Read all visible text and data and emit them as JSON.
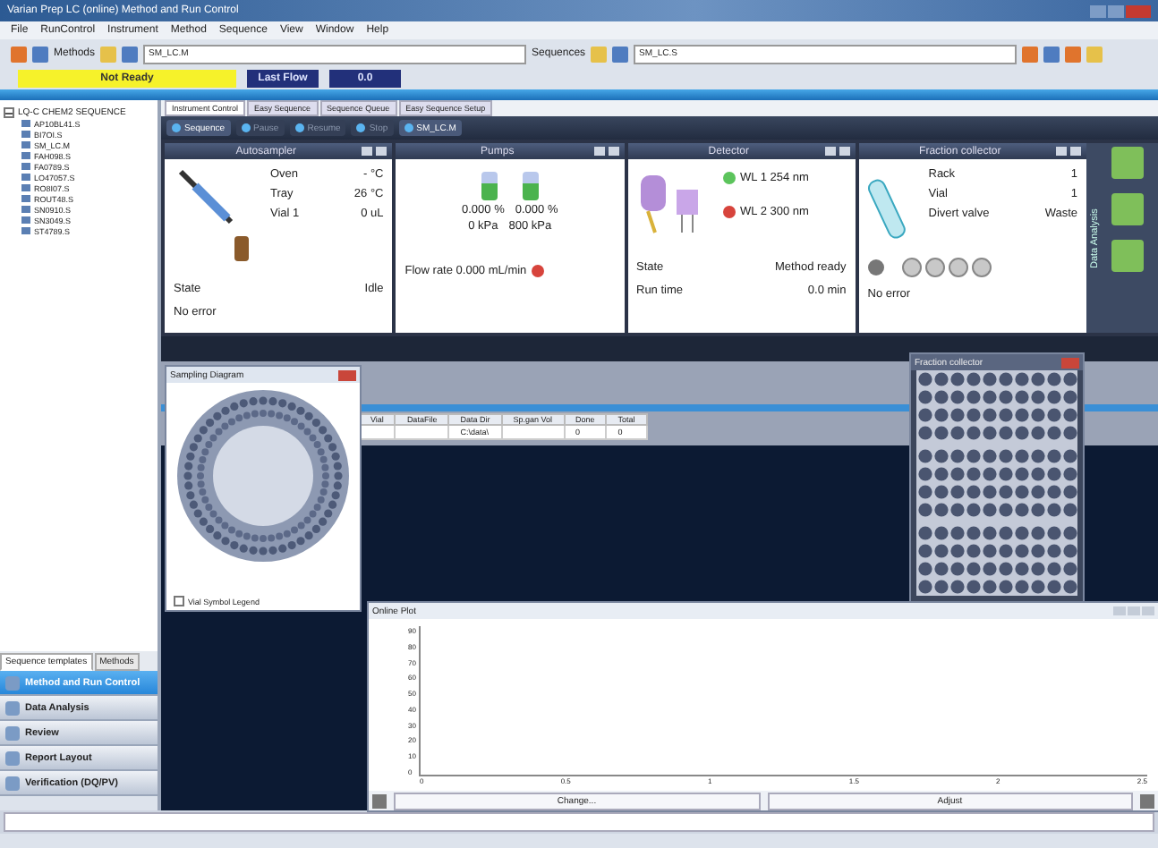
{
  "window": {
    "title": "Varian Prep LC (online) Method and Run Control"
  },
  "menu": [
    "File",
    "RunControl",
    "Instrument",
    "Method",
    "Sequence",
    "View",
    "Window",
    "Help"
  ],
  "toolbar": {
    "methods_label": "Methods",
    "method_value": "SM_LC.M",
    "sequences_label": "Sequences",
    "sequence_value": "SM_LC.S"
  },
  "status": [
    {
      "text": "Not Ready",
      "kind": "warning"
    },
    {
      "text": "Last Flow",
      "kind": "info"
    },
    {
      "text": "0.0",
      "kind": "info"
    }
  ],
  "tree": {
    "label": "LQ-C CHEM2 SEQUENCE",
    "expanded": true,
    "children": [
      {
        "label": "AP10BL41.S"
      },
      {
        "label": "BI7OI.S"
      },
      {
        "label": "SM_LC.M"
      },
      {
        "label": "FAH098.S"
      },
      {
        "label": "FA0789.S"
      },
      {
        "label": "LO47057.S"
      },
      {
        "label": "RO8I07.S"
      },
      {
        "label": "ROUT48.S"
      },
      {
        "label": "SN0910.S"
      },
      {
        "label": "SN3049.S"
      },
      {
        "label": "ST4789.S"
      }
    ]
  },
  "sidebar_tabs": [
    {
      "label": "Sequence templates",
      "selected": true
    },
    {
      "label": "Methods",
      "selected": false
    }
  ],
  "nav": [
    {
      "label": "Method and Run Control",
      "selected": true
    },
    {
      "label": "Data Analysis",
      "selected": false
    },
    {
      "label": "Review",
      "selected": false
    },
    {
      "label": "Report Layout",
      "selected": false
    },
    {
      "label": "Verification (DQ/PV)",
      "selected": false
    }
  ],
  "tabs": [
    {
      "label": "Instrument Control",
      "selected": true
    },
    {
      "label": "Easy Sequence",
      "selected": false
    },
    {
      "label": "Sequence Queue",
      "selected": false
    },
    {
      "label": "Easy Sequence Setup",
      "selected": false
    }
  ],
  "run_controls": [
    {
      "label": "Sequence",
      "disabled": false
    },
    {
      "label": "Pause",
      "disabled": true
    },
    {
      "label": "Resume",
      "disabled": true
    },
    {
      "label": "Stop",
      "disabled": true
    },
    {
      "label": "SM_LC.M",
      "disabled": false
    }
  ],
  "modules": [
    {
      "kind": "autosampler",
      "title": "Autosampler",
      "rows": [
        {
          "label": "Oven",
          "value": "- °C"
        },
        {
          "label": "Tray",
          "value": "26 °C"
        },
        {
          "label": "Vial 1",
          "value": "0 uL"
        }
      ],
      "footer": [
        {
          "label": "State",
          "value": "Idle"
        },
        {
          "label": "No error"
        }
      ]
    },
    {
      "kind": "pumps",
      "title": "Pumps",
      "percents": [
        "0.000 %",
        "0.000 %"
      ],
      "pressures": [
        "0 kPa",
        "800 kPa"
      ],
      "flow": "Flow rate 0.000 mL/min"
    },
    {
      "kind": "detector",
      "title": "Detector",
      "rows": [
        {
          "label": "WL 1 254 nm",
          "on": true
        },
        {
          "label": "WL 2 300 nm",
          "on": false
        }
      ],
      "footer": [
        {
          "label": "State",
          "value": "Method ready"
        },
        {
          "label": "Run time",
          "value": "0.0 min"
        }
      ]
    },
    {
      "kind": "fraction",
      "title": "Fraction collector",
      "rows": [
        {
          "label": "Rack",
          "value": "1"
        },
        {
          "label": "Vial",
          "value": "1"
        },
        {
          "label": "Divert valve",
          "value": "Waste"
        }
      ],
      "status": "No error"
    }
  ],
  "side_panel": {
    "title": "Data Analysis"
  },
  "table": {
    "columns": [
      "Vial",
      "DataFile",
      "Data Dir",
      "Sp.gan Vol",
      "Done",
      "Total"
    ],
    "rows": [
      [
        "",
        "",
        "C:\\data\\",
        "",
        "0",
        "0"
      ]
    ]
  },
  "sampling_diagram": {
    "title": "Sampling Diagram",
    "legend": "Vial Symbol Legend",
    "legend_checked": false
  },
  "rack": {
    "title": "Fraction collector"
  },
  "plot": {
    "title": "Online Plot",
    "yticks": [
      "90",
      "80",
      "70",
      "60",
      "50",
      "40",
      "30",
      "20",
      "10",
      "0"
    ],
    "xticks": [
      "0",
      "0.5",
      "1",
      "1.5",
      "2",
      "2.5"
    ],
    "buttons": [
      "Change...",
      "Adjust"
    ]
  }
}
